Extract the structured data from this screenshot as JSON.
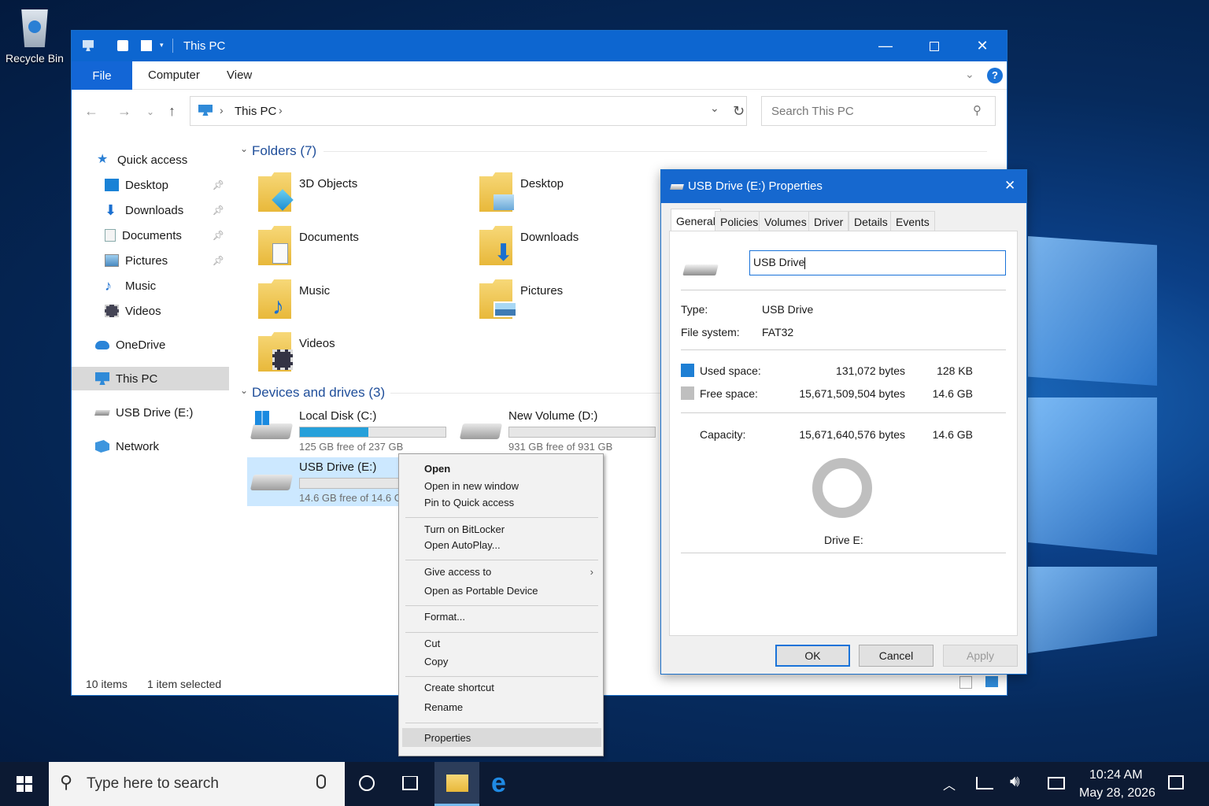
{
  "desktop": {
    "recycle_bin_label": "Recycle Bin"
  },
  "explorer": {
    "title": "This PC",
    "ribbon_tabs": [
      "File",
      "Computer",
      "View"
    ],
    "address": {
      "location": "This PC"
    },
    "search_placeholder": "Search This PC",
    "sidebar": [
      {
        "label": "Quick access",
        "icon": "star-icon",
        "pinned": false
      },
      {
        "label": "Desktop",
        "icon": "desktop-icon",
        "pinned": true
      },
      {
        "label": "Downloads",
        "icon": "download-icon",
        "pinned": true
      },
      {
        "label": "Documents",
        "icon": "document-icon",
        "pinned": true
      },
      {
        "label": "Pictures",
        "icon": "picture-icon",
        "pinned": true
      },
      {
        "label": "Music",
        "icon": "music-icon",
        "pinned": false
      },
      {
        "label": "Videos",
        "icon": "video-icon",
        "pinned": false
      },
      {
        "label": "OneDrive",
        "icon": "cloud-icon",
        "pinned": false
      },
      {
        "label": "This PC",
        "icon": "computer-icon",
        "pinned": false
      },
      {
        "label": "USB Drive (E:)",
        "icon": "usb-drive-icon",
        "pinned": false
      },
      {
        "label": "Network",
        "icon": "network-icon",
        "pinned": false
      }
    ],
    "folders_header": "Folders (7)",
    "folders": [
      "3D Objects",
      "Desktop",
      "Documents",
      "Downloads",
      "Music",
      "Pictures",
      "Videos"
    ],
    "drives_header": "Devices and drives (3)",
    "drives": [
      {
        "name": "Local Disk (C:)",
        "free_text": "125 GB free of 237 GB",
        "used_fraction": 0.47
      },
      {
        "name": "New Volume (D:)",
        "free_text": "931 GB free of 931 GB",
        "used_fraction": 0.0
      },
      {
        "name": "USB Drive (E:)",
        "free_text": "14.6 GB free of 14.6 GB",
        "used_fraction": 0.0
      }
    ],
    "status": {
      "items": "10 items",
      "selected": "1 item selected"
    }
  },
  "context_menu": {
    "open": "Open",
    "open_new_window": "Open in new window",
    "pin_quick_access": "Pin to Quick access",
    "bitlocker": "Turn on BitLocker",
    "autoplay": "Open AutoPlay...",
    "give_access": "Give access to",
    "portable_device": "Open as Portable Device",
    "format": "Format...",
    "cut": "Cut",
    "copy": "Copy",
    "create_shortcut": "Create shortcut",
    "rename": "Rename",
    "properties": "Properties"
  },
  "properties_dialog": {
    "title": "USB Drive (E:) Properties",
    "tabs": [
      "General",
      "Policies",
      "Volumes",
      "Driver",
      "Details",
      "Events"
    ],
    "name_value": "USB Drive",
    "type_label": "Type:",
    "type_value": "USB Drive",
    "fs_label": "File system:",
    "fs_value": "FAT32",
    "used_label": "Used space:",
    "used_bytes": "131,072 bytes",
    "used_short": "128 KB",
    "free_label": "Free space:",
    "free_bytes": "15,671,509,504 bytes",
    "free_short": "14.6 GB",
    "capacity_label": "Capacity:",
    "capacity_bytes": "15,671,640,576 bytes",
    "capacity_short": "14.6 GB",
    "drive_label": "Drive E:",
    "used_color": "#1e7fd4",
    "free_color": "#bfbfbf",
    "ok": "OK",
    "cancel": "Cancel",
    "apply": "Apply"
  },
  "taskbar": {
    "search_placeholder": "Type here to search",
    "time": "10:24 AM",
    "date": "May 28, 2026"
  }
}
